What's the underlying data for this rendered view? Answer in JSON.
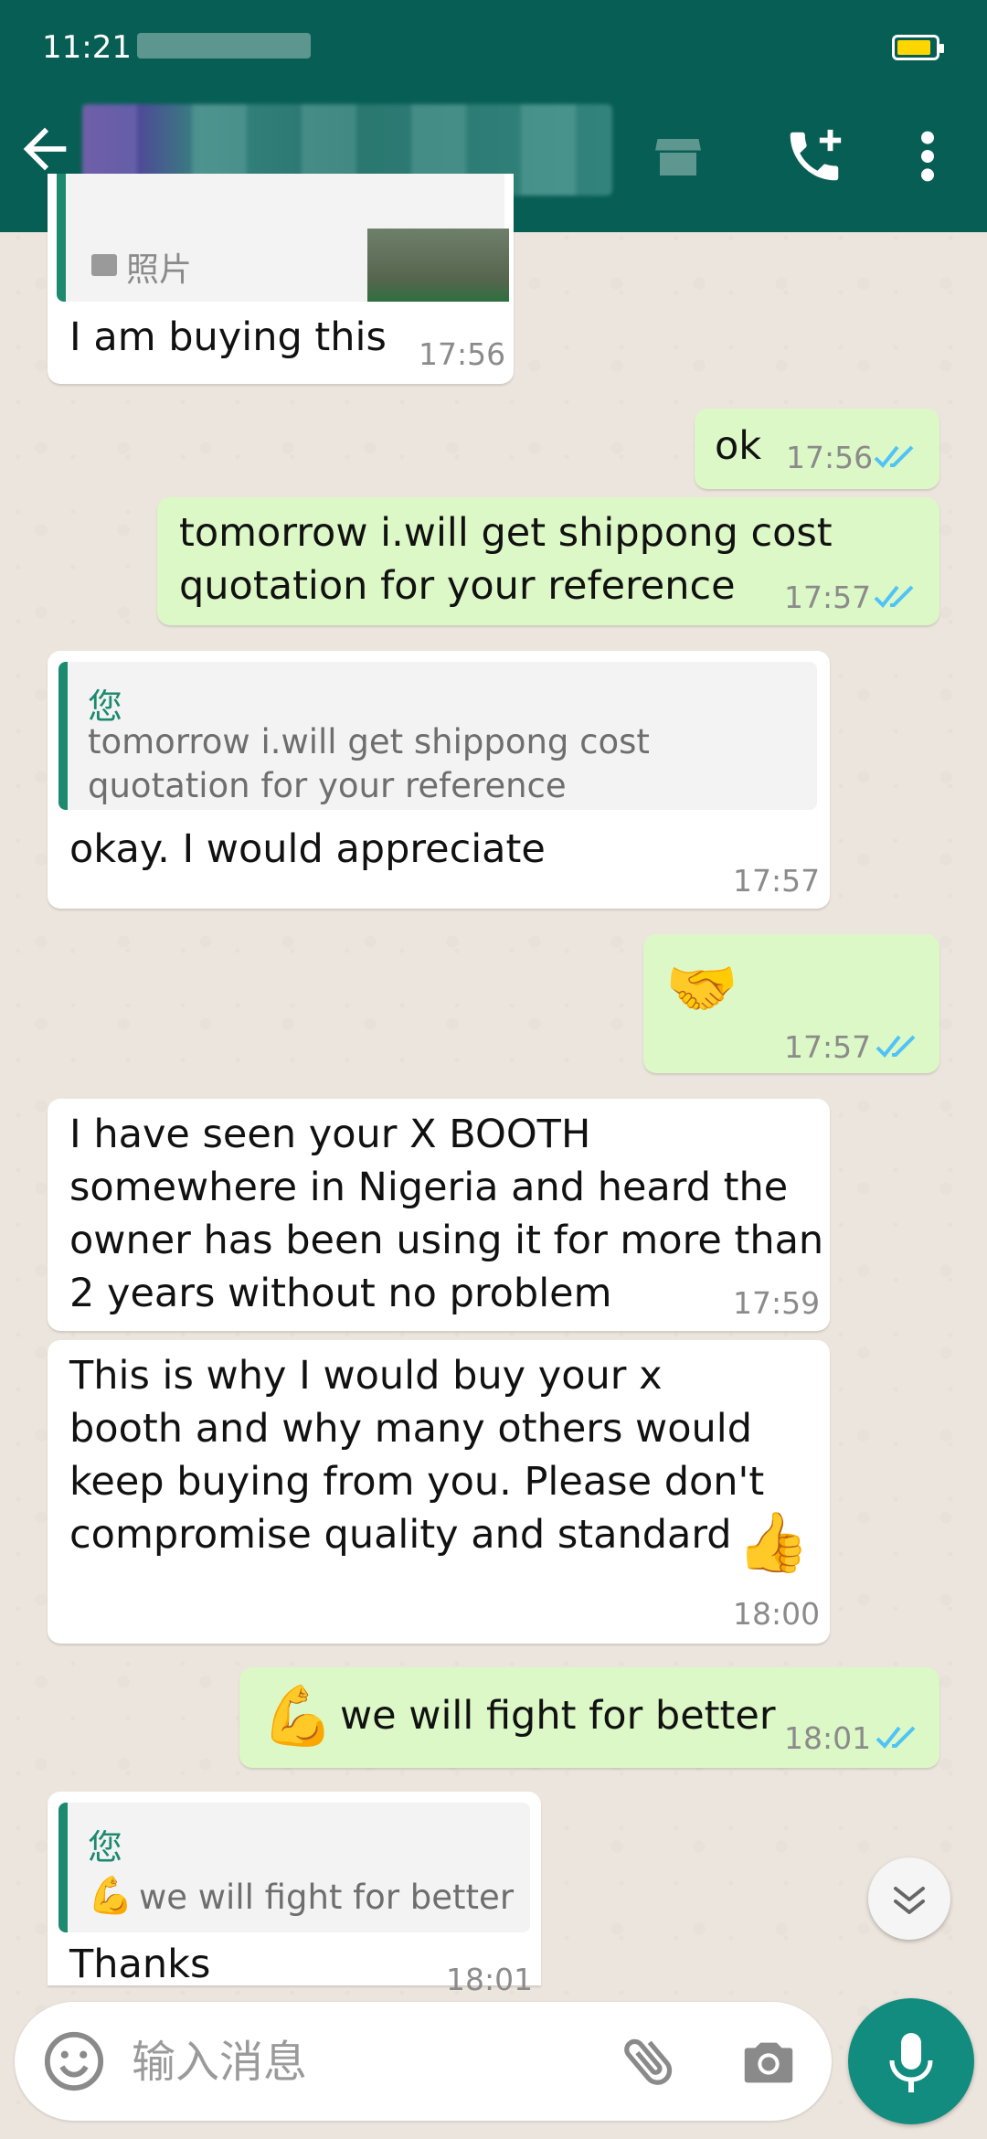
{
  "status_bar": {
    "time": "11:21"
  },
  "header": {
    "back_icon": "arrow-left-icon",
    "call_icon": "add-call-icon",
    "menu_icon": "more-vertical-icon"
  },
  "messages": [
    {
      "id": "m0",
      "direction": "in",
      "reply_label": "照片",
      "text": "I am buying this",
      "time": "17:56"
    },
    {
      "id": "m1",
      "direction": "out",
      "text": "ok",
      "time": "17:56",
      "status": "read"
    },
    {
      "id": "m2",
      "direction": "out",
      "text": "tomorrow i.will get shippong cost\nquotation for your reference",
      "time": "17:57",
      "status": "read"
    },
    {
      "id": "m3",
      "direction": "in",
      "quote_author": "您",
      "quote_text": "tomorrow i.will get shippong cost\nquotation for your reference",
      "text": "okay. I would appreciate",
      "time": "17:57"
    },
    {
      "id": "m4",
      "direction": "out",
      "emoji": "🤝",
      "time": "17:57",
      "status": "read"
    },
    {
      "id": "m5",
      "direction": "in",
      "text": "I have seen your X BOOTH\nsomewhere in Nigeria and heard the\nowner has been using it for more than\n2 years without no problem",
      "time": "17:59"
    },
    {
      "id": "m6",
      "direction": "in",
      "text": "This is why I would buy your x\nbooth and why many others would\nkeep buying from you. Please don't\ncompromise quality and standard",
      "emoji": "👍",
      "time": "18:00"
    },
    {
      "id": "m7",
      "direction": "out",
      "emoji": "💪",
      "text": "we will fight for better",
      "time": "18:01",
      "status": "read"
    },
    {
      "id": "m8",
      "direction": "in",
      "quote_author": "您",
      "quote_emoji": "💪",
      "quote_text": "we will fight for better",
      "text": "Thanks",
      "time": "18:01"
    }
  ],
  "input": {
    "placeholder": "输入消息",
    "value": ""
  },
  "colors": {
    "header": "#075e54",
    "outgoing": "#dcf8c6",
    "incoming": "#ffffff",
    "read_ticks": "#4fc3f7",
    "quote_bar": "#1c8a6f",
    "mic": "#128c7e"
  }
}
